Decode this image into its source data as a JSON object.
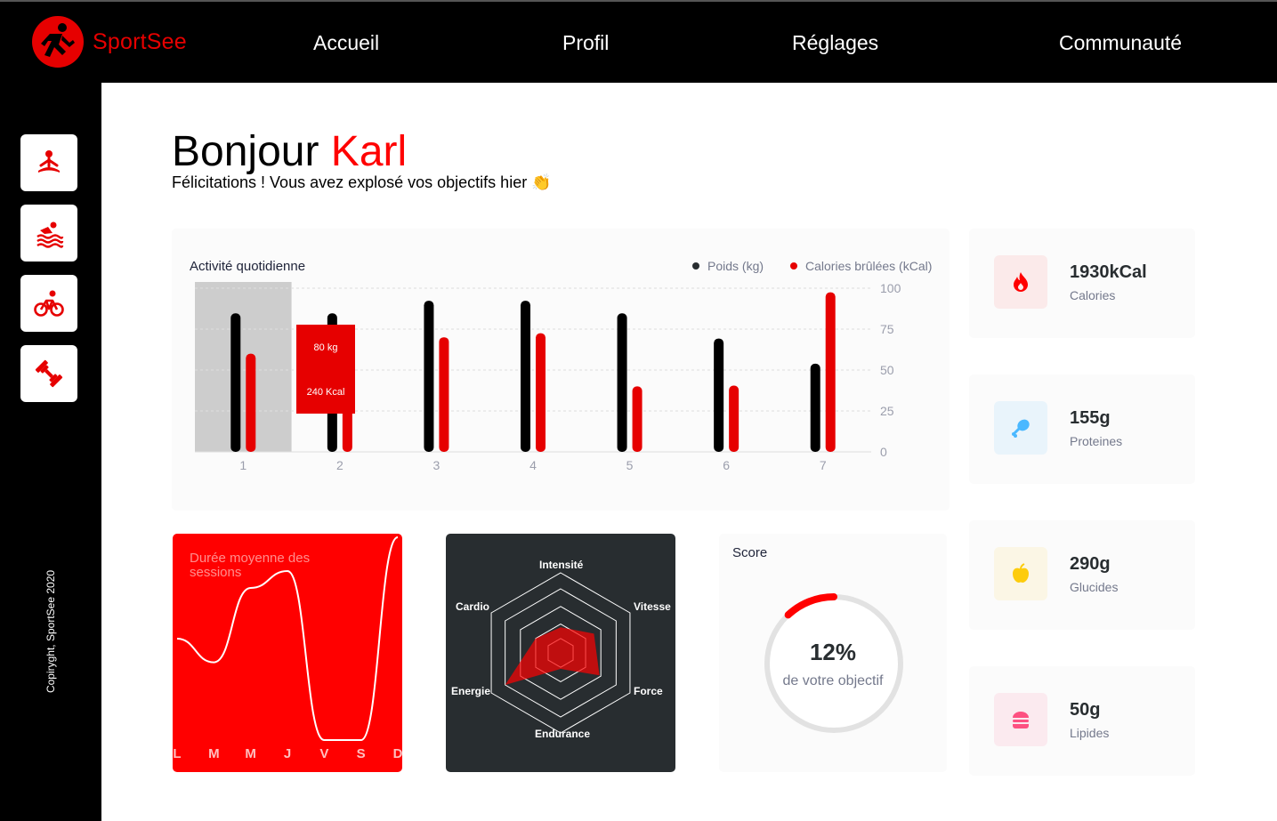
{
  "brand": {
    "name": "SportSee",
    "color": "#E60000",
    "icon": "runner-logo-icon"
  },
  "nav": {
    "items": [
      "Accueil",
      "Profil",
      "Réglages",
      "Communauté"
    ]
  },
  "sidebar": {
    "buttons": [
      {
        "icon": "yoga-icon"
      },
      {
        "icon": "swimming-icon"
      },
      {
        "icon": "cycling-icon"
      },
      {
        "icon": "dumbbell-icon"
      }
    ],
    "copyright": "Copiryght, SportSee 2020"
  },
  "greeting": {
    "hello": "Bonjour",
    "name": "Karl",
    "message": "Félicitations ! Vous avez explosé vos objectifs hier 👏"
  },
  "activity": {
    "title": "Activité quotidienne",
    "legend": [
      {
        "label": "Poids (kg)",
        "color": "#282D30"
      },
      {
        "label": "Calories brûlées (kCal)",
        "color": "#E60000"
      }
    ],
    "tooltip": {
      "weight": "80 kg",
      "calories": "240 Kcal"
    },
    "active_day": 1
  },
  "nutrition": [
    {
      "value": "1930kCal",
      "label": "Calories",
      "icon": "fire-icon",
      "bg": "#FBEAEA",
      "color": "#FF0000"
    },
    {
      "value": "155g",
      "label": "Proteines",
      "icon": "chicken-icon",
      "bg": "#E9F4FB",
      "color": "#4AB8FF"
    },
    {
      "value": "290g",
      "label": "Glucides",
      "icon": "apple-icon",
      "bg": "#FBF6E5",
      "color": "#FDCC0C"
    },
    {
      "value": "50g",
      "label": "Lipides",
      "icon": "burger-icon",
      "bg": "#FBEAEF",
      "color": "#FD5181"
    }
  ],
  "sessions": {
    "title": "Durée moyenne des sessions"
  },
  "performance": {
    "labels": [
      "Intensité",
      "Vitesse",
      "Force",
      "Endurance",
      "Energie",
      "Cardio"
    ]
  },
  "score": {
    "title": "Score",
    "percent": "12%",
    "subtitle": "de votre objectif",
    "value": 0.12
  },
  "chart_data": [
    {
      "type": "bar",
      "title": "Activité quotidienne",
      "categories": [
        "1",
        "2",
        "3",
        "4",
        "5",
        "6",
        "7"
      ],
      "series": [
        {
          "name": "Poids (kg)",
          "values": [
            80,
            80,
            81,
            81,
            80,
            78,
            76
          ]
        },
        {
          "name": "Calories brûlées (kCal)",
          "values": [
            240,
            220,
            280,
            290,
            160,
            162,
            390
          ]
        }
      ],
      "yticks": [
        "0",
        "25",
        "50",
        "75",
        "100"
      ],
      "y_ticks_values": [
        0,
        25,
        50,
        75,
        100
      ],
      "ylim": [
        0,
        100
      ],
      "weight_scale": [
        69,
        82
      ],
      "calorie_scale": [
        0,
        400
      ]
    },
    {
      "type": "line",
      "title": "Durée moyenne des sessions",
      "categories": [
        "L",
        "M",
        "M",
        "J",
        "V",
        "S",
        "D"
      ],
      "values": [
        30,
        23,
        45,
        50,
        0,
        0,
        60
      ],
      "ylim": [
        0,
        60
      ]
    },
    {
      "type": "radar",
      "axes": [
        "Intensité",
        "Vitesse",
        "Force",
        "Endurance",
        "Energie",
        "Cardio"
      ],
      "values": [
        80,
        120,
        140,
        50,
        200,
        90
      ],
      "max": 250
    },
    {
      "type": "pie",
      "title": "Score",
      "values": [
        12,
        88
      ],
      "labels": [
        "Score",
        ""
      ]
    }
  ]
}
